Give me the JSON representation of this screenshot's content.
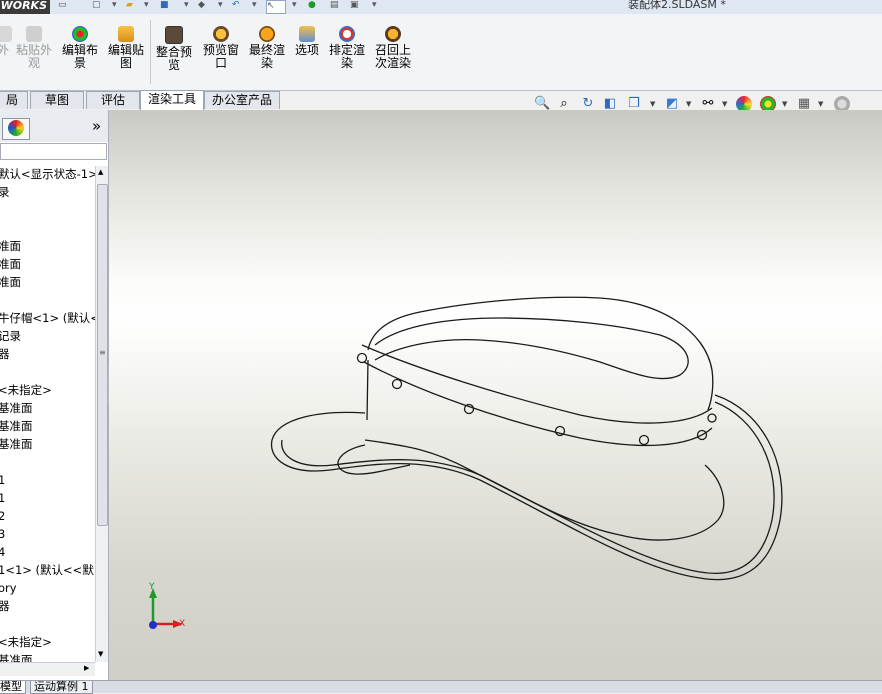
{
  "app": {
    "logo_text": "WORKS",
    "document_title": "装配体2.SLDASM *"
  },
  "ribbon": {
    "buttons": [
      {
        "label_line1": "外",
        "label_line2": "",
        "disabled": true
      },
      {
        "label_line1": "粘贴外",
        "label_line2": "观",
        "disabled": true
      },
      {
        "label_line1": "编辑布",
        "label_line2": "景",
        "disabled": false
      },
      {
        "label_line1": "编辑贴",
        "label_line2": "图",
        "disabled": false
      },
      {
        "label_line1": "整合预",
        "label_line2": "览",
        "disabled": false
      },
      {
        "label_line1": "预览窗",
        "label_line2": "口",
        "disabled": false
      },
      {
        "label_line1": "最终渲",
        "label_line2": "染",
        "disabled": false
      },
      {
        "label_line1": "选项",
        "label_line2": "",
        "disabled": false
      },
      {
        "label_line1": "排定渲",
        "label_line2": "染",
        "disabled": false
      },
      {
        "label_line1": "召回上",
        "label_line2": "次渲染",
        "disabled": false
      }
    ]
  },
  "tabs": [
    "局",
    "草图",
    "评估",
    "渲染工具",
    "办公室产品"
  ],
  "active_tab": "渲染工具",
  "left_panel": {
    "expand_glyph": "»",
    "tree_items": [
      "默认<显示状态-1>",
      "录",
      "准面",
      "准面",
      "准面",
      "牛仔帽<1> (默认<",
      "记录",
      "器",
      "<未指定>",
      "基准面",
      "基准面",
      "基准面",
      "1",
      "1",
      "2",
      "3",
      "4",
      "1<1> (默认<<默",
      "ory",
      "器",
      "<未指定>",
      "基准面"
    ]
  },
  "viewport": {
    "triad_y": "Y",
    "triad_x": "X"
  },
  "bottom_tabs": [
    "模型",
    "运动算例 1"
  ],
  "colors": {
    "accent": "#2f6bbd",
    "axis_x": "#d62020",
    "axis_y": "#1c9a2a",
    "axis_z": "#2030c8"
  }
}
